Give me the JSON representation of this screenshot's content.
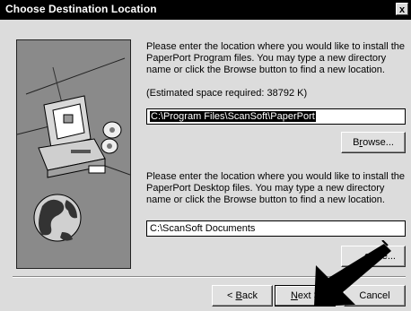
{
  "window": {
    "title": "Choose Destination Location",
    "close_glyph": "x"
  },
  "program_section": {
    "instructions": "Please enter the location where you would like to install the PaperPort Program files.  You may type a new directory name or click the Browse button to find a new location.",
    "space_required": "(Estimated space required:  38792 K)",
    "path_value": "C:\\Program Files\\ScanSoft\\PaperPort",
    "browse_label": "Browse..."
  },
  "desktop_section": {
    "instructions": "Please enter the location where you would like to install the PaperPort Desktop files.  You may type a new directory name or click the Browse button to find a new location.",
    "path_value": "C:\\ScanSoft Documents",
    "browse_label": "owse..."
  },
  "buttons": {
    "back_label": "< Back",
    "next_label": "Next >",
    "cancel_label": "Cancel"
  },
  "art": {
    "panel_color": "#8a8a8a",
    "icons": [
      "computer-icon",
      "cd-icon",
      "globe-icon"
    ]
  },
  "annotation": {
    "icon": "pointer-arrow-icon",
    "color": "#000000"
  }
}
